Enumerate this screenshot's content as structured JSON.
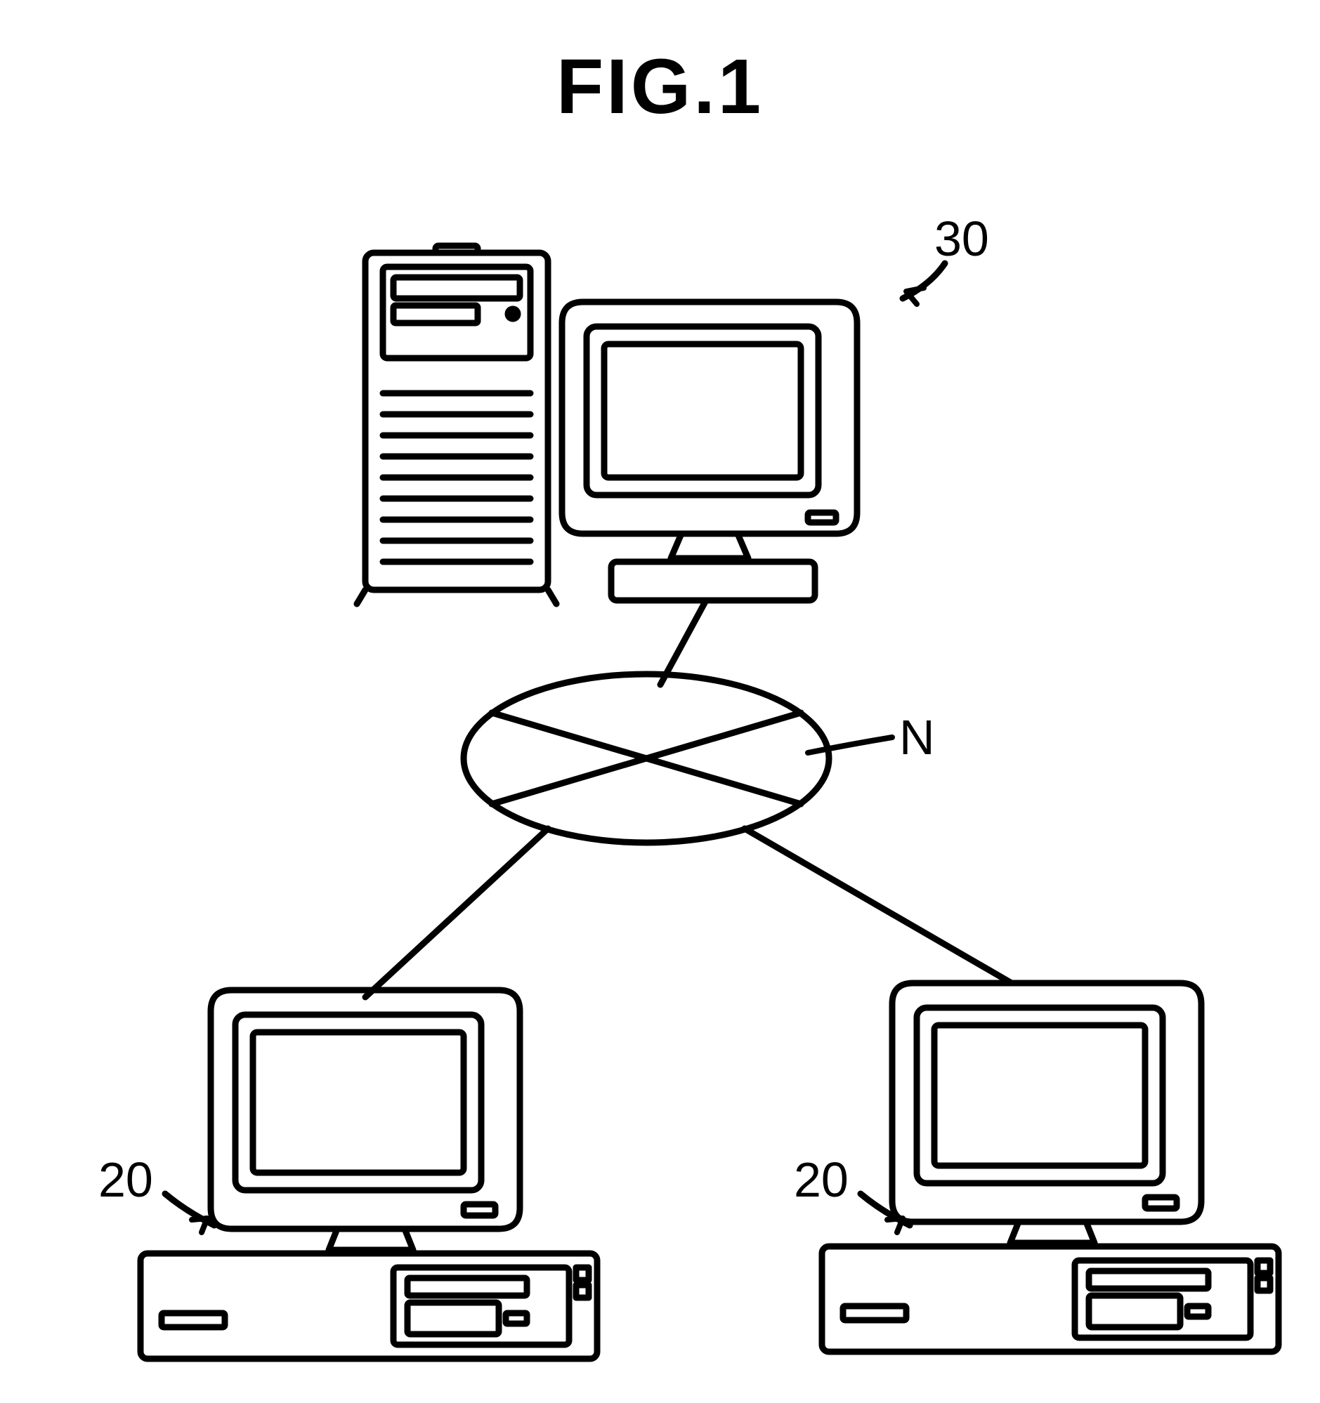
{
  "title": "FIG.1",
  "labels": {
    "server": "30",
    "network": "N",
    "client_left": "20",
    "client_right": "20"
  },
  "diagram": {
    "nodes": [
      {
        "id": "server",
        "type": "server-with-monitor",
        "label_ref": "30"
      },
      {
        "id": "network",
        "type": "network-hub",
        "label_ref": "N"
      },
      {
        "id": "client_left",
        "type": "desktop-pc",
        "label_ref": "20"
      },
      {
        "id": "client_right",
        "type": "desktop-pc",
        "label_ref": "20"
      }
    ],
    "edges": [
      {
        "from": "server",
        "to": "network"
      },
      {
        "from": "client_left",
        "to": "network"
      },
      {
        "from": "client_right",
        "to": "network"
      }
    ]
  }
}
